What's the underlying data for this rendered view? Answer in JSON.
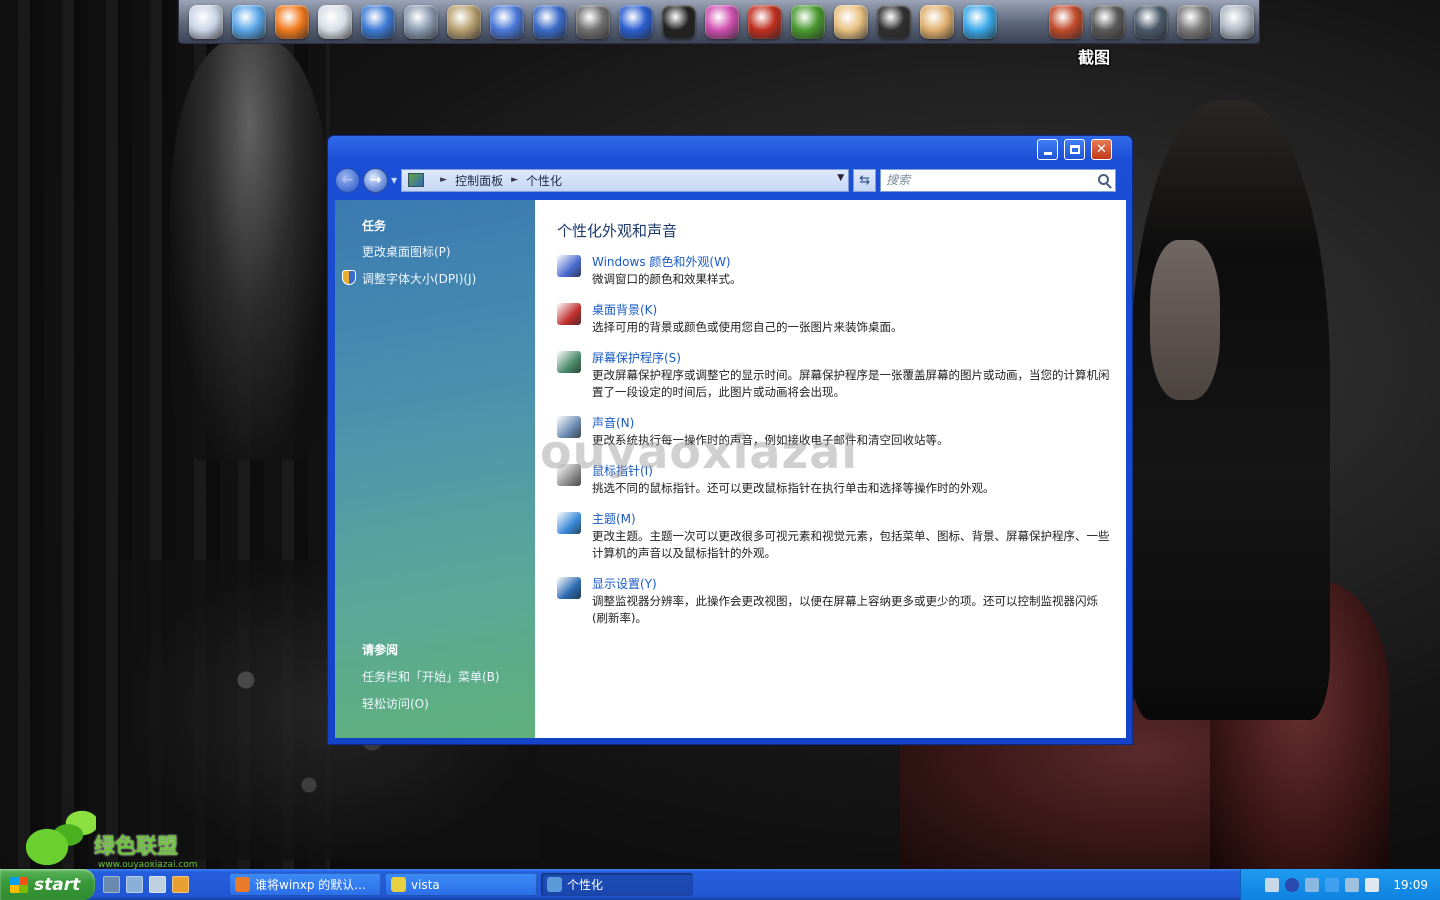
{
  "dock": {
    "hover_label": "截图",
    "icons": [
      {
        "name": "finder-icon",
        "color": "#c9d4e6"
      },
      {
        "name": "safari-compass-icon",
        "color": "#5aa6e8"
      },
      {
        "name": "firefox-icon",
        "color": "#f07a1e"
      },
      {
        "name": "microphone-icon",
        "color": "#d8dde6"
      },
      {
        "name": "weather-icon",
        "color": "#3d7bd6"
      },
      {
        "name": "photo-icon",
        "color": "#8a9ab0"
      },
      {
        "name": "books-icon",
        "color": "#b7a070"
      },
      {
        "name": "feather-icon",
        "color": "#4a78d8"
      },
      {
        "name": "movie-clapper-icon",
        "color": "#3a6ac8"
      },
      {
        "name": "audio-speaker-icon",
        "color": "#707070"
      },
      {
        "name": "bluetooth-icon",
        "color": "#2b5fd0"
      },
      {
        "name": "qq-penguin-icon",
        "color": "#222222"
      },
      {
        "name": "color-wheel-icon",
        "color": "#d050b0"
      },
      {
        "name": "graph-icon",
        "color": "#c03020"
      },
      {
        "name": "frog-icon",
        "color": "#4a9a30"
      },
      {
        "name": "boy-character-icon",
        "color": "#e8c080"
      },
      {
        "name": "penguin-character-icon",
        "color": "#303030"
      },
      {
        "name": "girl-character-icon",
        "color": "#e0b070"
      },
      {
        "name": "diamond-icon",
        "color": "#3aa8e8"
      },
      {
        "name": "blank-slot-icon",
        "color": "transparent"
      },
      {
        "name": "media-player-icon",
        "color": "#c04a2a"
      },
      {
        "name": "film-reel-icon",
        "color": "#5a5a5a"
      },
      {
        "name": "time-machine-icon",
        "color": "#4a5a6a"
      },
      {
        "name": "system-preferences-icon",
        "color": "#7a7a7a"
      },
      {
        "name": "trash-icon",
        "color": "#b0b8c4"
      }
    ]
  },
  "window": {
    "address": {
      "crumbs": [
        "控制面板",
        "个性化"
      ]
    },
    "search": {
      "placeholder": "搜索"
    },
    "sidebar": {
      "tasks_heading": "任务",
      "task_links": [
        "更改桌面图标(P)",
        "调整字体大小(DPI)(J)"
      ],
      "see_also_heading": "请参阅",
      "see_also_links": [
        "任务栏和「开始」菜单(B)",
        "轻松访问(O)"
      ]
    },
    "main": {
      "title": "个性化外观和声音",
      "items": [
        {
          "link": "Windows 颜色和外观(W)",
          "desc": "微调窗口的颜色和效果样式。",
          "icon_color": "#4a6ad0"
        },
        {
          "link": "桌面背景(K)",
          "desc": "选择可用的背景或颜色或使用您自己的一张图片来装饰桌面。",
          "icon_color": "#c03030"
        },
        {
          "link": "屏幕保护程序(S)",
          "desc": "更改屏幕保护程序或调整它的显示时间。屏幕保护程序是一张覆盖屏幕的图片或动画，当您的计算机闲置了一段设定的时间后，此图片或动画将会出现。",
          "icon_color": "#4a8a6a"
        },
        {
          "link": "声音(N)",
          "desc": "更改系统执行每一操作时的声音，例如接收电子邮件和清空回收站等。",
          "icon_color": "#6a8ab0"
        },
        {
          "link": "鼠标指针(I)",
          "desc": "挑选不同的鼠标指针。还可以更改鼠标指针在执行单击和选择等操作时的外观。",
          "icon_color": "#909090"
        },
        {
          "link": "主题(M)",
          "desc": "更改主题。主题一次可以更改很多可视元素和视觉元素，包括菜单、图标、背景、屏幕保护程序、一些计算机的声音以及鼠标指针的外观。",
          "icon_color": "#3a8ad8"
        },
        {
          "link": "显示设置(Y)",
          "desc": "调整监视器分辨率，此操作会更改视图，以便在屏幕上容纳更多或更少的项。还可以控制监视器闪烁(刷新率)。",
          "icon_color": "#2a6ab0"
        }
      ]
    }
  },
  "watermark": {
    "overlay_text": "ouyaoxiazai",
    "logo_text": "绿色联盟",
    "logo_url": "www.ouyaoxiazai.com"
  },
  "taskbar": {
    "start_label": "start",
    "tasks": [
      {
        "label": "谁将winxp 的默认...",
        "icon_color": "#e87a2a",
        "active": false
      },
      {
        "label": "vista",
        "icon_color": "#e8d040",
        "active": false
      },
      {
        "label": "个性化",
        "icon_color": "#5a9ad8",
        "active": true
      }
    ],
    "clock": "19:09"
  }
}
